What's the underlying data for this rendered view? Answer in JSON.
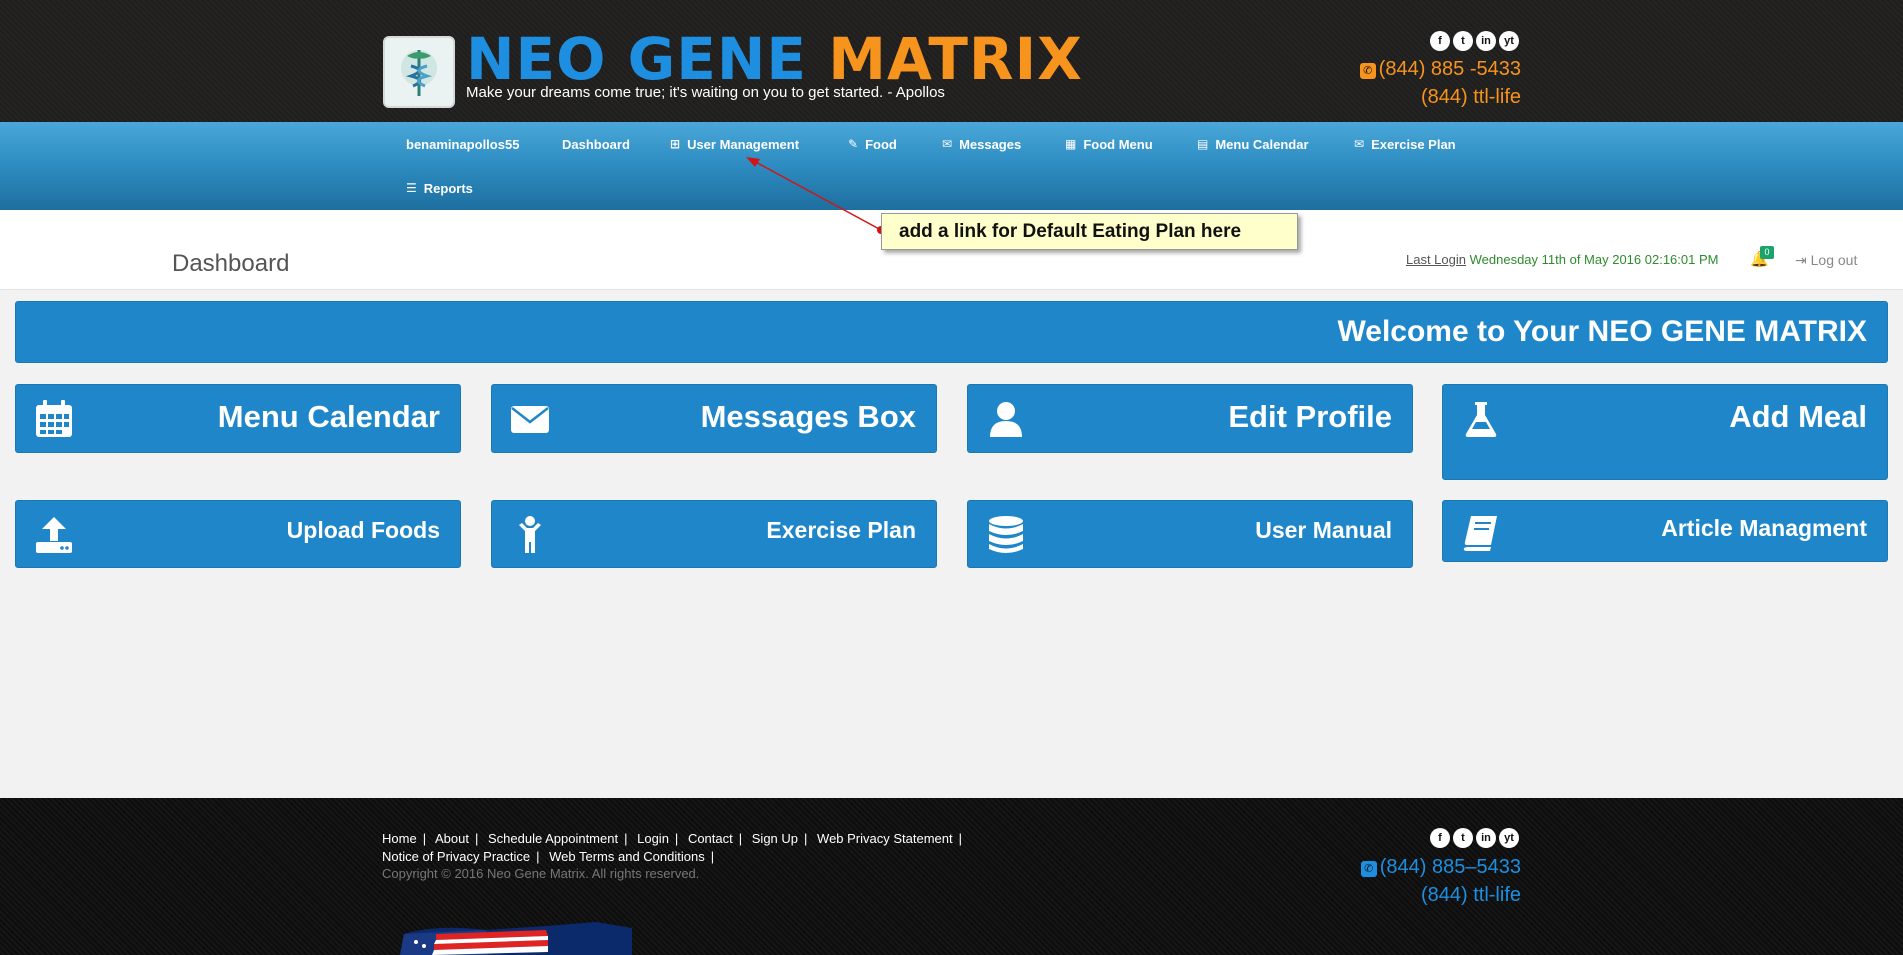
{
  "brand": {
    "name_part1": "NEO GENE",
    "name_part2": "MATRIX",
    "tagline": "Make your dreams come true; it's waiting on you to get started.  -  Apollos"
  },
  "header": {
    "social": [
      "f",
      "t",
      "in",
      "yt"
    ],
    "phone1": "(844) 885 -5433",
    "phone2": "(844) ttl-life",
    "phone_color": "#f7941d"
  },
  "nav": {
    "items": [
      {
        "label": "benaminapollos55",
        "icon": ""
      },
      {
        "label": "Dashboard",
        "icon": ""
      },
      {
        "label": "User Management",
        "icon": "sitemap-icon"
      },
      {
        "label": "Food",
        "icon": "edit-icon"
      },
      {
        "label": "Messages",
        "icon": "envelope-icon"
      },
      {
        "label": "Food Menu",
        "icon": "table-icon"
      },
      {
        "label": "Menu Calendar",
        "icon": "calendar-icon"
      },
      {
        "label": "Exercise Plan",
        "icon": "envelope-icon"
      },
      {
        "label": "Reports",
        "icon": "sliders-icon"
      }
    ]
  },
  "page": {
    "title": "Dashboard",
    "last_login_label": "Last Login",
    "last_login_value": "Wednesday 11th of May 2016 02:16:01 PM",
    "notification_count": "0",
    "logout_label": "Log out"
  },
  "annotation": {
    "text": "add a link for Default Eating Plan here"
  },
  "dashboard": {
    "welcome": "Welcome to Your NEO GENE MATRIX",
    "tiles": [
      {
        "label": "Menu Calendar",
        "icon": "calendar-icon"
      },
      {
        "label": "Messages Box",
        "icon": "envelope-icon"
      },
      {
        "label": "Edit Profile",
        "icon": "user-icon"
      },
      {
        "label": "Add Meal",
        "icon": "flask-icon"
      },
      {
        "label": "Upload Foods",
        "icon": "upload-icon"
      },
      {
        "label": "Exercise Plan",
        "icon": "child-icon"
      },
      {
        "label": "User Manual",
        "icon": "database-icon"
      },
      {
        "label": "Article Managment",
        "icon": "book-icon"
      }
    ],
    "accent_color": "#1f87c9"
  },
  "footer": {
    "links": [
      "Home",
      "About",
      "Schedule Appointment",
      "Login",
      "Contact",
      "Sign Up",
      "Web Privacy Statement",
      "Notice of Privacy Practice",
      "Web Terms and Conditions"
    ],
    "copyright": "Copyright © 2016 Neo Gene Matrix. All rights reserved.",
    "phone1": "(844) 885–5433",
    "phone2": "(844) ttl-life",
    "phone_color": "#1e8fe0"
  }
}
